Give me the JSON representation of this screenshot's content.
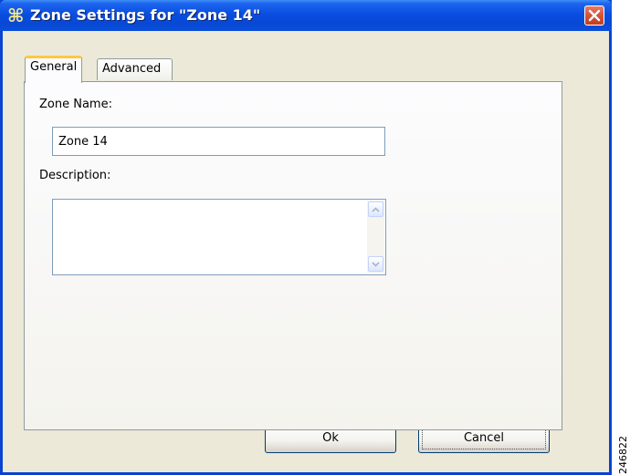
{
  "window": {
    "title": "Zone Settings for \"Zone 14\"",
    "icon": "cisco-scos-icon",
    "close_icon": "close-icon"
  },
  "tabs": [
    {
      "label": "General",
      "selected": true
    },
    {
      "label": "Advanced",
      "selected": false
    }
  ],
  "general": {
    "zone_name_label": "Zone Name:",
    "zone_name_value": "Zone 14",
    "description_label": "Description:",
    "description_value": ""
  },
  "buttons": {
    "ok_label": "Ok",
    "cancel_label": "Cancel"
  },
  "figure_id": "246822",
  "colors": {
    "titlebar": "#0a4ee0",
    "close_button": "#d8553a",
    "dialog_bg": "#ece9d8",
    "selected_tab_accent": "#ffc83c",
    "field_border": "#7f9db9"
  }
}
